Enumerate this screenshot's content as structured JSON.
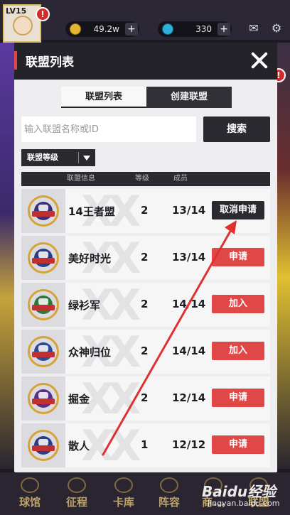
{
  "topbar": {
    "level": "LV15",
    "gold": "49.2w",
    "gems": "330"
  },
  "modal": {
    "title": "联盟列表",
    "tabs": [
      {
        "label": "联盟列表"
      },
      {
        "label": "创建联盟"
      }
    ],
    "search": {
      "placeholder": "输入联盟名称或ID",
      "button_label": "搜索"
    },
    "sort": {
      "label": "联盟等级"
    },
    "columns": {
      "info": "联盟信息",
      "level": "等级",
      "members": "成员"
    },
    "guilds": [
      {
        "name": "14王者盟",
        "level": "2",
        "members": "13/14",
        "action": "取消申请",
        "emblem_color": "#3a2f7a"
      },
      {
        "name": "美好时光",
        "level": "2",
        "members": "13/14",
        "action": "申请",
        "emblem_color": "#2a3f88"
      },
      {
        "name": "绿衫军",
        "level": "2",
        "members": "14/14",
        "action": "加入",
        "emblem_color": "#2a7a3a"
      },
      {
        "name": "众神归位",
        "level": "2",
        "members": "14/14",
        "action": "加入",
        "emblem_color": "#2a4a9a"
      },
      {
        "name": "掘金",
        "level": "2",
        "members": "12/14",
        "action": "申请",
        "emblem_color": "#5a2f8a"
      },
      {
        "name": "散人",
        "level": "1",
        "members": "12/12",
        "action": "申请",
        "emblem_color": "#2a3f88"
      }
    ]
  },
  "bottom_nav": [
    {
      "label": "球馆"
    },
    {
      "label": "征程"
    },
    {
      "label": "卡库"
    },
    {
      "label": "阵容"
    },
    {
      "label": "商..."
    },
    {
      "label": "联盟"
    }
  ],
  "watermark": {
    "brand": "Baidu经验",
    "url": "jingyan.baidu.com"
  },
  "colors": {
    "accent_red": "#e04848",
    "dark": "#2b2a30",
    "annotation_arrow": "#e03030"
  }
}
